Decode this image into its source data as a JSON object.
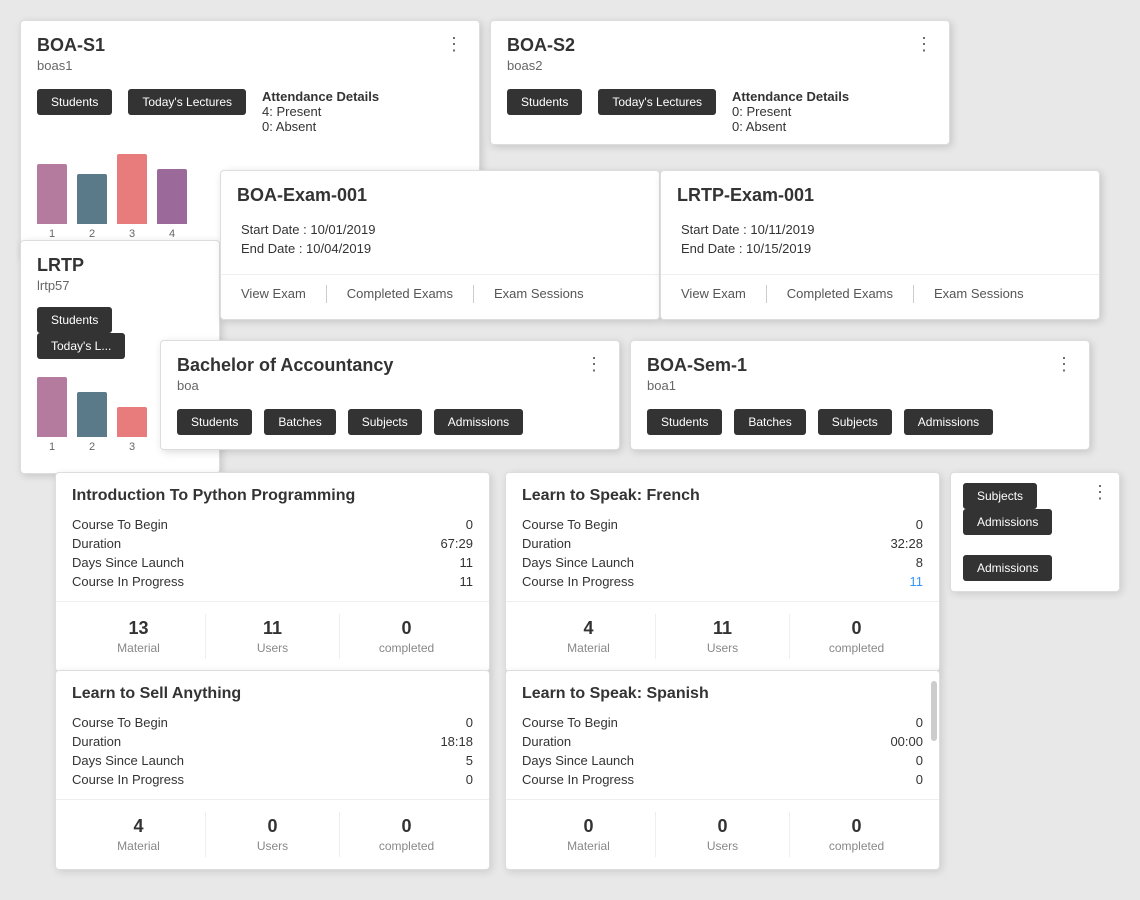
{
  "boas1": {
    "title": "BOA-S1",
    "subtitle": "boas1",
    "buttons": [
      "Students",
      "Today's Lectures"
    ],
    "attendance_label": "Attendance Details",
    "attendance_present": "4: Present",
    "attendance_absent": "0: Absent",
    "chart_bars": [
      {
        "color": "#b57b9e",
        "height": 60,
        "label": "1"
      },
      {
        "color": "#5a7a8a",
        "height": 50,
        "label": "2"
      },
      {
        "color": "#e87b7b",
        "height": 70,
        "label": "3"
      },
      {
        "color": "#9b6a9b",
        "height": 55,
        "label": "4"
      }
    ]
  },
  "boas2": {
    "title": "BOA-S2",
    "subtitle": "boas2",
    "buttons": [
      "Students",
      "Today's Lectures"
    ],
    "attendance_label": "Attendance Details",
    "attendance_present": "0: Present",
    "attendance_absent": "0: Absent"
  },
  "lrtp": {
    "title": "LRTP",
    "subtitle": "lrtp57",
    "buttons": [
      "Students",
      "Today's L..."
    ],
    "chart_bars": [
      {
        "color": "#b57b9e",
        "height": 60,
        "label": "1"
      },
      {
        "color": "#5a7a8a",
        "height": 45,
        "label": "2"
      },
      {
        "color": "#e87b7b",
        "height": 30,
        "label": "3"
      }
    ]
  },
  "exam_boa": {
    "title": "BOA-Exam-001",
    "start_date": "Start Date : 10/01/2019",
    "end_date": "End Date : 10/04/2019",
    "actions": [
      "View Exam",
      "Completed Exams",
      "Exam Sessions"
    ]
  },
  "exam_lrtp": {
    "title": "LRTP-Exam-001",
    "start_date": "Start Date : 10/11/2019",
    "end_date": "End Date : 10/15/2019",
    "actions": [
      "View Exam",
      "Completed Exams",
      "Exam Sessions"
    ]
  },
  "boa_prog": {
    "title": "Bachelor of Accountancy",
    "subtitle": "boa",
    "buttons": [
      "Students",
      "Batches",
      "Subjects",
      "Admissions"
    ]
  },
  "boa_sem": {
    "title": "BOA-Sem-1",
    "subtitle": "boa1",
    "buttons": [
      "Students",
      "Batches",
      "Subjects",
      "Admissions"
    ]
  },
  "course_python": {
    "title": "Introduction To Python Programming",
    "stats": [
      {
        "label": "Course To Begin",
        "value": "0"
      },
      {
        "label": "Duration",
        "value": "67:29"
      },
      {
        "label": "Days Since Launch",
        "value": "11"
      },
      {
        "label": "Course In Progress",
        "value": "11",
        "highlight": false
      }
    ],
    "footer": [
      {
        "number": "13",
        "label": "Material"
      },
      {
        "number": "11",
        "label": "Users"
      },
      {
        "number": "0",
        "label": "completed"
      }
    ]
  },
  "course_french": {
    "title": "Learn to Speak: French",
    "stats": [
      {
        "label": "Course To Begin",
        "value": "0"
      },
      {
        "label": "Duration",
        "value": "32:28"
      },
      {
        "label": "Days Since Launch",
        "value": "8"
      },
      {
        "label": "Course In Progress",
        "value": "11",
        "highlight": true
      }
    ],
    "footer": [
      {
        "number": "4",
        "label": "Material"
      },
      {
        "number": "11",
        "label": "Users"
      },
      {
        "number": "0",
        "label": "completed"
      }
    ]
  },
  "course_sell": {
    "title": "Learn to Sell Anything",
    "stats": [
      {
        "label": "Course To Begin",
        "value": "0"
      },
      {
        "label": "Duration",
        "value": "18:18"
      },
      {
        "label": "Days Since Launch",
        "value": "5"
      },
      {
        "label": "Course In Progress",
        "value": "0",
        "highlight": false
      }
    ],
    "footer": [
      {
        "number": "4",
        "label": "Material"
      },
      {
        "number": "0",
        "label": "Users"
      },
      {
        "number": "0",
        "label": "completed"
      }
    ]
  },
  "course_spanish": {
    "title": "Learn to Speak: Spanish",
    "stats": [
      {
        "label": "Course To Begin",
        "value": "0"
      },
      {
        "label": "Duration",
        "value": "00:00"
      },
      {
        "label": "Days Since Launch",
        "value": "0"
      },
      {
        "label": "Course In Progress",
        "value": "0",
        "highlight": false
      }
    ],
    "footer": [
      {
        "number": "0",
        "label": "Material"
      },
      {
        "number": "0",
        "label": "Users"
      },
      {
        "number": "0",
        "label": "completed"
      }
    ]
  },
  "dots_icon": "⋮",
  "labels": {
    "subjects": "Subjects",
    "admissions": "Admissions"
  }
}
